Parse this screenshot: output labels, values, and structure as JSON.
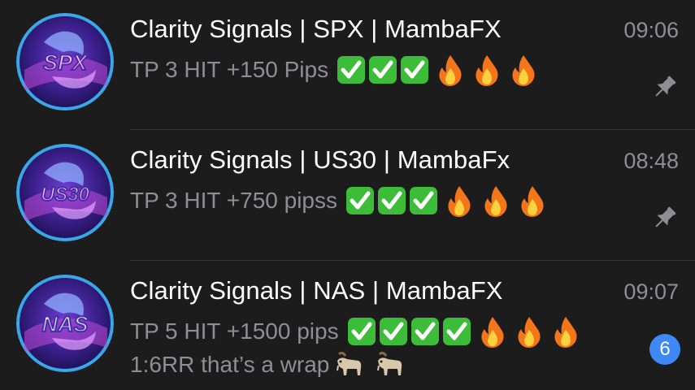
{
  "colors": {
    "background": "#1c1c1d",
    "title": "#ffffff",
    "secondary": "#8e8e93",
    "badge": "#3e88f7",
    "check_green": "#3dbc3a",
    "fire_orange": "#f5761a",
    "divider": "#38383a"
  },
  "chats": [
    {
      "avatar_label": "SPX",
      "title": "Clarity Signals | SPX | MambaFX",
      "time": "09:06",
      "preview": "TP 3 HIT +150 Pips",
      "checks": 3,
      "fires": 3,
      "pinned": true,
      "icon": "pin-icon"
    },
    {
      "avatar_label": "US30",
      "title": "Clarity Signals | US30 | MambaFx",
      "time": "08:48",
      "preview": "TP 3 HIT +750 pipss",
      "checks": 3,
      "fires": 3,
      "pinned": true,
      "icon": "pin-icon"
    },
    {
      "avatar_label": "NAS",
      "title": "Clarity Signals | NAS | MambaFX",
      "time": "09:07",
      "preview": "TP 5 HIT +1500 pips",
      "preview_line2": "1:6RR that’s a wrap",
      "checks": 4,
      "fires": 3,
      "goats": 2,
      "pinned": false,
      "unread_count": "6"
    }
  ]
}
